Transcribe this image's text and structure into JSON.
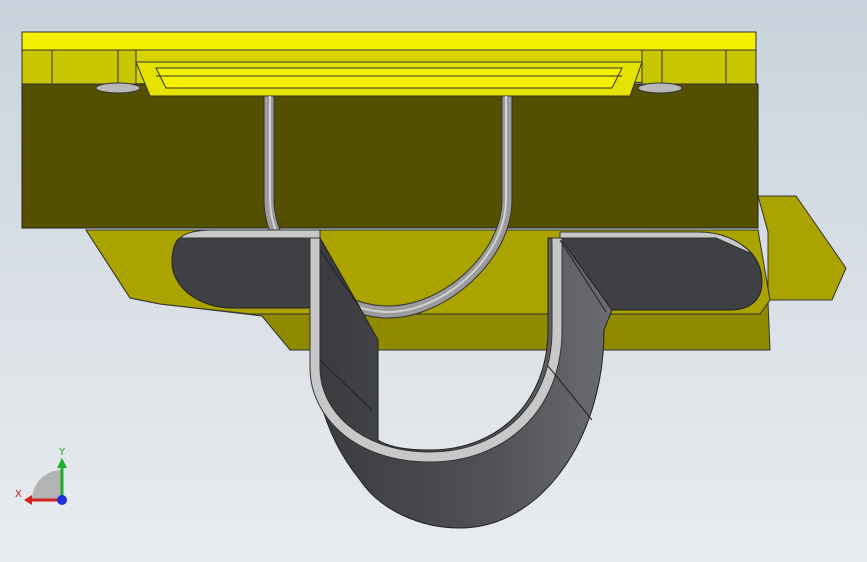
{
  "viewport": {
    "background_top": "#c9d2dc",
    "background_bottom": "#e9ecef"
  },
  "model": {
    "colors": {
      "plate_top": "#f4f000",
      "plate_top_dark": "#d8d400",
      "plate_front": "#545000",
      "plate_edge": "#8a8400",
      "lower_plate": "#aaa300",
      "lower_plate_dark": "#8f8a00",
      "clamp_dark": "#3f4044",
      "clamp_mid": "#55575c",
      "clamp_light": "#7a7c80",
      "clamp_edge": "#c8c8c8",
      "rod": "#9c9c9c",
      "rod_light": "#d2d2d2"
    }
  },
  "triad": {
    "x_label": "X",
    "y_label": "Y",
    "x_color": "#d22020",
    "y_color": "#1fae2a",
    "z_color": "#1d2fd6"
  }
}
